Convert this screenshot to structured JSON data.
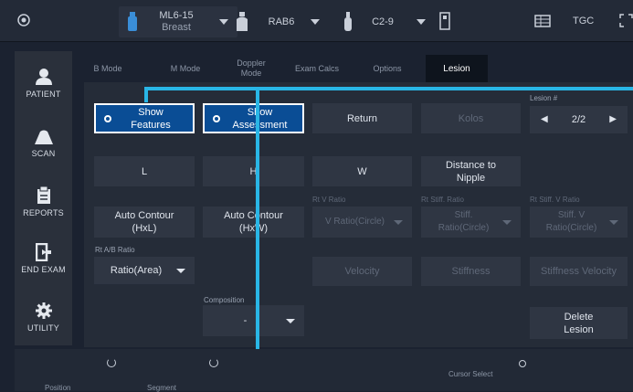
{
  "probes": [
    {
      "model": "ML6-15",
      "preset": "Breast"
    },
    {
      "model": "RAB6",
      "preset": ""
    },
    {
      "model": "C2-9",
      "preset": ""
    }
  ],
  "top_right": {
    "tgc_label": "TGC"
  },
  "sidebar": {
    "items": [
      {
        "label": "PATIENT",
        "icon": "person-icon"
      },
      {
        "label": "SCAN",
        "icon": "scan-probe-icon"
      },
      {
        "label": "REPORTS",
        "icon": "clipboard-icon"
      },
      {
        "label": "END EXAM",
        "icon": "exit-icon"
      },
      {
        "label": "UTILITY",
        "icon": "gear-icon"
      }
    ]
  },
  "tabs": [
    {
      "label": "B Mode"
    },
    {
      "label": "M Mode"
    },
    {
      "label": "Doppler Mode"
    },
    {
      "label": "Exam Calcs"
    },
    {
      "label": "Options"
    },
    {
      "label": "Lesion"
    }
  ],
  "lesion": {
    "show_features": "Show Features",
    "show_assessment": "Show Assessment",
    "return": "Return",
    "kolos": "Kolos",
    "lesion_num_label": "Lesion #",
    "lesion_num_value": "2/2",
    "l": "L",
    "h": "H",
    "w": "W",
    "distance_to_nipple": "Distance to Nipple",
    "auto_contour_hxl": "Auto Contour (HxL)",
    "auto_contour_hxw": "Auto Contour (HxW)",
    "rt_v_ratio_label": "Rt V Ratio",
    "v_ratio_value": "V Ratio(Circle)",
    "rt_stiff_ratio_label": "Rt Stiff. Ratio",
    "stiff_ratio_value": "Stiff. Ratio(Circle)",
    "rt_stiff_v_ratio_label": "Rt Stiff. V Ratio",
    "stiff_v_ratio_value": "Stiff. V Ratio(Circle)",
    "rt_ab_ratio_label": "Rt A/B Ratio",
    "ab_ratio_value": "Ratio(Area)",
    "velocity": "Velocity",
    "stiffness": "Stiffness",
    "stiffness_velocity": "Stiffness Velocity",
    "composition_label": "Composition",
    "composition_value": "-",
    "delete_lesion": "Delete Lesion"
  },
  "bottom": {
    "position": "Position",
    "segment": "Segment",
    "cursor_select": "Cursor Select"
  },
  "colors": {
    "selected_bg": "#0a4d95",
    "highlight": "#29b6e6"
  }
}
